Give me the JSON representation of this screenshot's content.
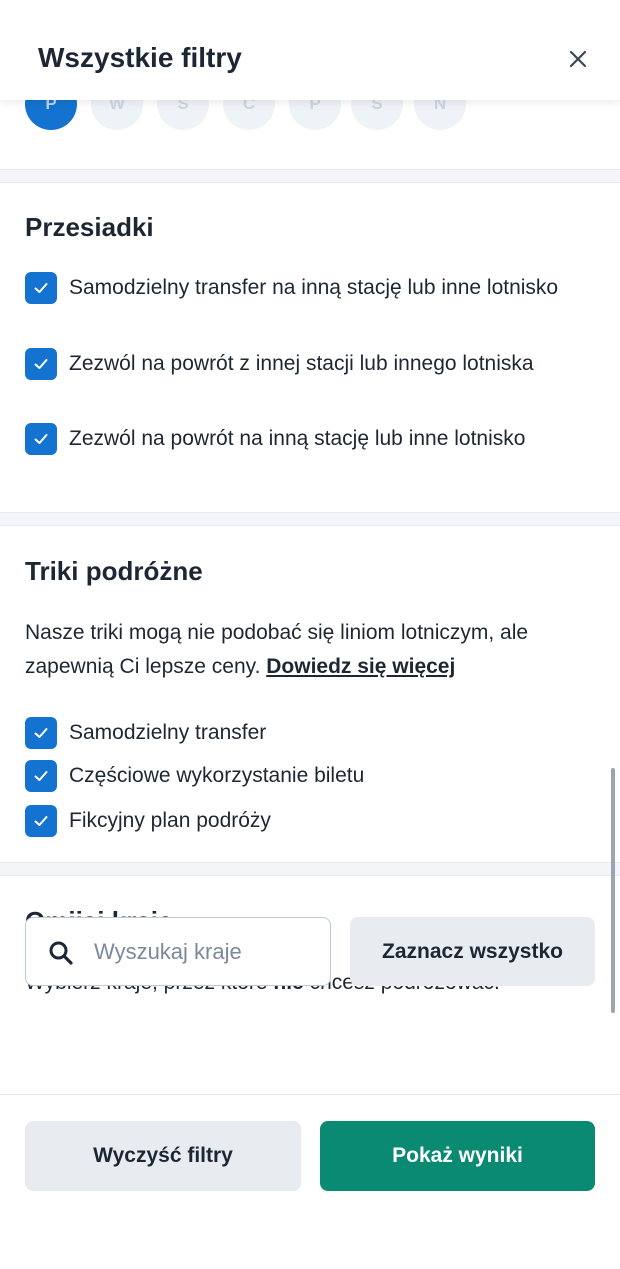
{
  "header": {
    "title": "Wszystkie filtry",
    "close_icon": "close-icon"
  },
  "days": [
    {
      "label": "P",
      "active": true
    },
    {
      "label": "W",
      "active": false
    },
    {
      "label": "Ś",
      "active": false
    },
    {
      "label": "C",
      "active": false
    },
    {
      "label": "P",
      "active": false
    },
    {
      "label": "S",
      "active": false
    },
    {
      "label": "N",
      "active": false
    }
  ],
  "transfers": {
    "title": "Przesiadki",
    "options": [
      {
        "label": "Samodzielny transfer na inną stację lub inne lotnisko",
        "checked": true
      },
      {
        "label": "Zezwól na powrót z innej stacji lub innego lotniska",
        "checked": true
      },
      {
        "label": "Zezwól na powrót na inną stację lub inne lotnisko",
        "checked": true
      }
    ]
  },
  "travel_hacks": {
    "title": "Triki podróżne",
    "description": "Nasze triki mogą nie podobać się liniom lotniczym, ale zapewnią Ci lepsze ceny.",
    "link": "Dowiedz się więcej",
    "options": [
      {
        "label": "Samodzielny transfer",
        "checked": true
      },
      {
        "label": "Częściowe wykorzystanie biletu",
        "checked": true
      },
      {
        "label": "Fikcyjny plan podróży",
        "checked": true
      }
    ]
  },
  "exclude_countries": {
    "title": "Omijaj kraje",
    "description_before": "Wybierz kraje, przez które ",
    "description_bold": "nie",
    "description_after": " chcesz podróżować.",
    "search_placeholder": "Wyszukaj kraje",
    "search_value": "",
    "select_all": "Zaznacz wszystko"
  },
  "footer": {
    "clear": "Wyczyść filtry",
    "show": "Pokaż wyniki"
  },
  "colors": {
    "primary": "#1473d0",
    "success": "#0a8a73",
    "neutral": "#e8ecf0",
    "text": "#1d2733"
  }
}
